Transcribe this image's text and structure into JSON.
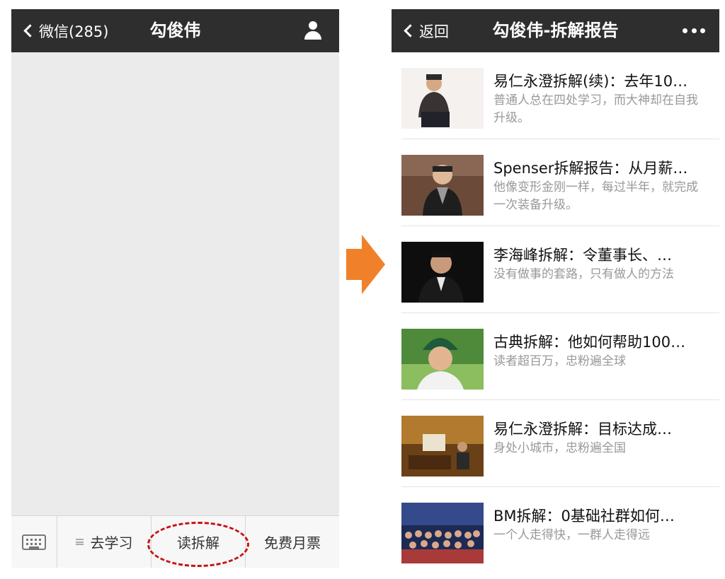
{
  "left": {
    "back_label": "微信(285)",
    "title": "勾俊伟",
    "menu": [
      "去学习",
      "读拆解",
      "免费月票"
    ]
  },
  "right": {
    "back_label": "返回",
    "title": "勾俊伟-拆解报告",
    "articles": [
      {
        "title": "易仁永澄拆解(续)：去年10…",
        "desc": "普通人总在四处学习，而大神却在自我升级。"
      },
      {
        "title": "Spenser拆解报告：从月薪…",
        "desc": "他像变形金刚一样，每过半年，就完成一次装备升级。"
      },
      {
        "title": "李海峰拆解：令董事长、…",
        "desc": "没有做事的套路，只有做人的方法"
      },
      {
        "title": "古典拆解：他如何帮助100…",
        "desc": "读者超百万，忠粉遍全球"
      },
      {
        "title": "易仁永澄拆解：目标达成…",
        "desc": "身处小城市，忠粉遍全国"
      },
      {
        "title": "BM拆解：0基础社群如何…",
        "desc": "一个人走得快，一群人走得远"
      }
    ]
  },
  "colors": {
    "topbar": "#2e2e2e",
    "highlight": "#c41414",
    "arrow": "#f0812a"
  }
}
